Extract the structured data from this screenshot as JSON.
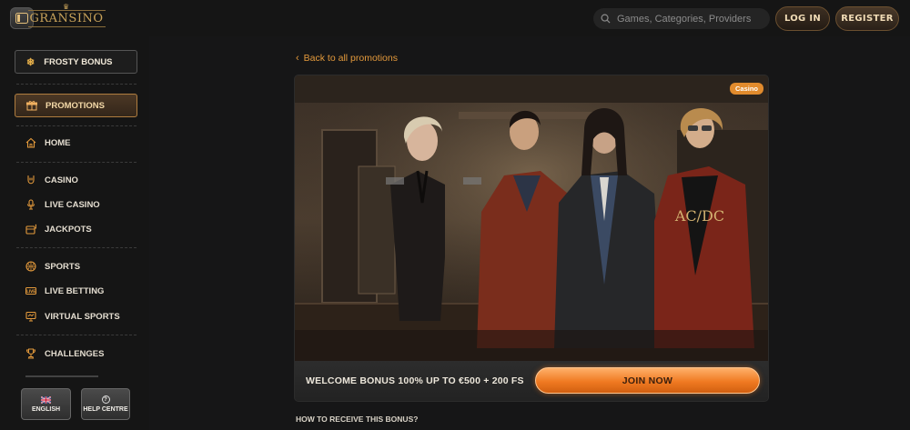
{
  "header": {
    "logo_text": "GRANSINO",
    "search_placeholder": "Games, Categories, Providers",
    "login_label": "LOG IN",
    "register_label": "REGISTER"
  },
  "sidebar": {
    "frosty_bonus": "FROSTY BONUS",
    "promotions": "PROMOTIONS",
    "items": [
      {
        "label": "HOME",
        "icon": "home-icon"
      },
      {
        "label": "CASINO",
        "icon": "rock-hand-icon"
      },
      {
        "label": "LIVE CASINO",
        "icon": "microphone-icon"
      },
      {
        "label": "JACKPOTS",
        "icon": "slot-machine-icon"
      },
      {
        "label": "SPORTS",
        "icon": "basketball-icon"
      },
      {
        "label": "LIVE BETTING",
        "icon": "live-icon"
      },
      {
        "label": "VIRTUAL SPORTS",
        "icon": "monitor-icon"
      },
      {
        "label": "CHALLENGES",
        "icon": "trophy-icon"
      }
    ],
    "language_label": "ENGLISH",
    "help_label": "HELP CENTRE"
  },
  "main": {
    "back_link": "Back to all promotions",
    "category_tag": "Casino",
    "promo_title": "WELCOME BONUS 100% UP TO €500 + 200 FS",
    "join_label": "JOIN NOW",
    "how_title": "HOW TO RECEIVE THIS BONUS?"
  },
  "colors": {
    "accent": "#e49a3c",
    "join_button": "#f07a22",
    "background": "#161617"
  }
}
